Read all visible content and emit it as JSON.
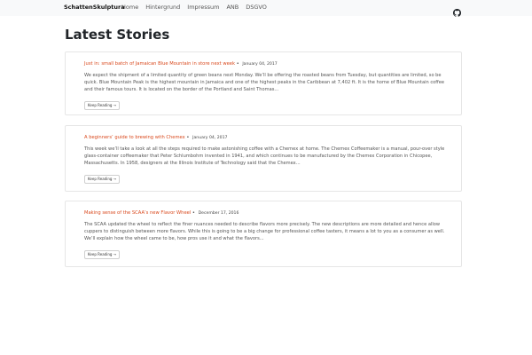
{
  "navbar": {
    "brand": "SchattenSkulptura",
    "links": [
      "Home",
      "Hintergrund",
      "Impressum",
      "ANB",
      "DSGVO"
    ]
  },
  "main": {
    "title": "Latest Stories",
    "posts": [
      {
        "title": "Just in: small batch of Jamaican Blue Mountain in store next week",
        "date": "January 04, 2017",
        "excerpt": "We expect the shipment of a limited quantity of green beans next Monday. We’ll be offering the roasted beans from Tuesday, but quantities are limited, so be quick. Blue Mountain Peak is the highest mountain in Jamaica and one of the highest peaks in the Caribbean at 7,402 ft. It is the home of Blue Mountain coffee and their famous tours. It is located on the border of the Portland and Saint Thomas...",
        "button": "Keep Reading →"
      },
      {
        "title": "A beginners’ guide to brewing with Chemex",
        "date": "January 04, 2017",
        "excerpt": "This week we’ll take a look at all the steps required to make astonishing coffee with a Chemex at home. The Chemex Coffeemaker is a manual, pour-over style glass-container coffeemaker that Peter Schlumbohm invented in 1941, and which continues to be manufactured by the Chemex Corporation in Chicopee, Massachusetts. In 1958, designers at the Illinois Institute of Technology said that the Chemex...",
        "button": "Keep Reading →"
      },
      {
        "title": "Making sense of the SCAA’s new Flavor Wheel",
        "date": "December 17, 2016",
        "excerpt": "The SCAA updated the wheel to reflect the finer nuances needed to describe flavors more precisely. The new descriptions are more detailed and hence allow cuppers to distinguish between more flavors. While this is going to be a big change for professional coffee tasters, it means a lot to you as a consumer as well. We’ll explain how the wheel came to be, how pros use it and what the flavors...",
        "button": "Keep Reading →"
      }
    ]
  },
  "colors": {
    "accent": "#d9481c",
    "navbar_bg": "#f8f9fa"
  },
  "icons": {
    "navbar_right": "github-icon"
  }
}
